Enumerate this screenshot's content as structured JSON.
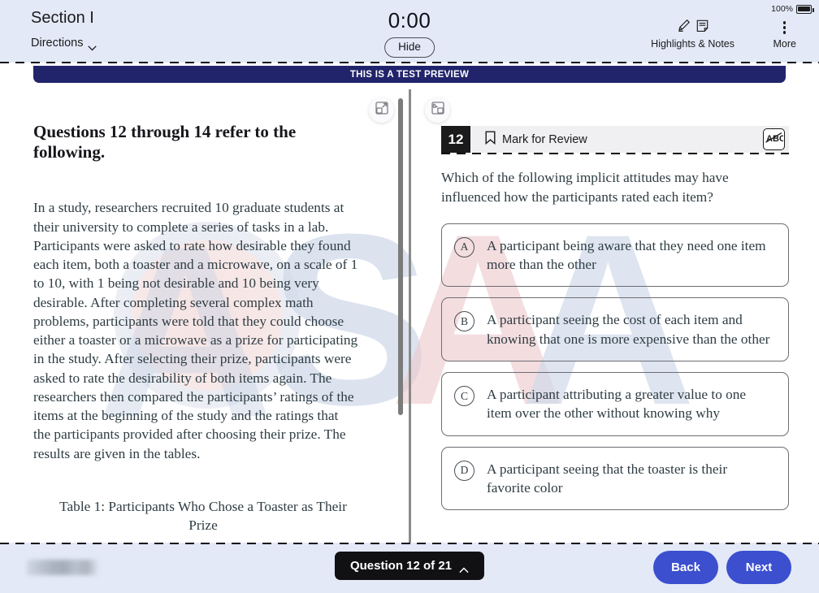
{
  "header": {
    "section_title": "Section I",
    "directions_label": "Directions",
    "timer": "0:00",
    "hide_label": "Hide",
    "battery_percent": "100%",
    "highlights_notes_label": "Highlights & Notes",
    "more_label": "More"
  },
  "banner": {
    "text": "THIS IS A TEST PREVIEW"
  },
  "panel_toggles": {
    "left_icon": "expand-panel-icon",
    "right_icon": "collapse-panel-icon"
  },
  "passage": {
    "heading": "Questions 12 through 14 refer to the following.",
    "body": "In a study, researchers recruited 10 graduate students at their university to complete a series of tasks in a lab. Participants were asked to rate how desirable they found each item, both a toaster and a microwave, on a scale of 1 to 10, with 1 being not desirable and 10 being very desirable. After completing several complex math problems, participants were told that they could choose either a toaster or a microwave as a prize for participating in the study. After selecting their prize, participants were asked to rate the desirability of both items again. The researchers then compared the participants’ ratings of the items at the beginning of the study and the ratings that the participants provided after choosing their prize. The results are given in the tables.",
    "table_caption": "Table 1: Participants Who Chose a Toaster as Their Prize"
  },
  "question": {
    "number": "12",
    "mark_for_review_label": "Mark for Review",
    "eliminator_icon": "abc-strikethrough-icon",
    "prompt": "Which of the following implicit attitudes may have influenced how the participants rated each item?",
    "choices": [
      {
        "letter": "A",
        "text": "A participant being aware that they need one item more than the other"
      },
      {
        "letter": "B",
        "text": "A participant seeing the cost of each item and knowing that one is more expensive than the other"
      },
      {
        "letter": "C",
        "text": "A participant attributing a greater value to one item over the other without knowing why"
      },
      {
        "letter": "D",
        "text": "A participant seeing that the toaster is their favorite color"
      }
    ]
  },
  "footer": {
    "question_nav": "Question 12 of 21",
    "back_label": "Back",
    "next_label": "Next"
  },
  "watermark": {
    "letters": [
      "A",
      "S",
      "A",
      "A"
    ]
  },
  "colors": {
    "header_bg": "#e3e9f7",
    "banner_bg": "#21246b",
    "primary_button": "#3b4fcf",
    "question_badge": "#1b1b1b"
  }
}
